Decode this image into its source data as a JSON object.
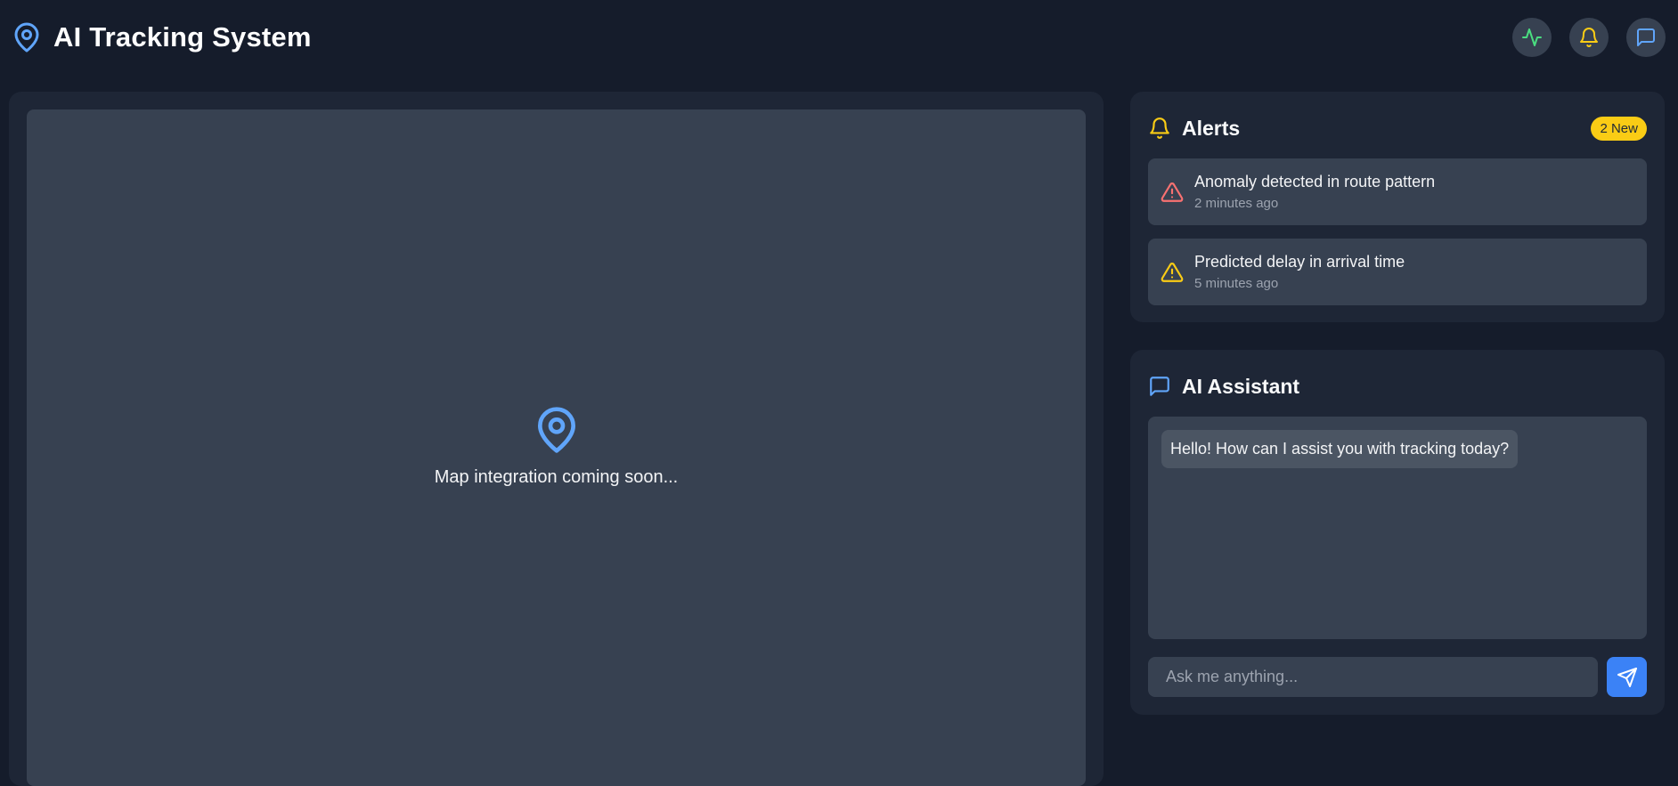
{
  "header": {
    "title": "AI Tracking System",
    "logo_icon": "map-pin-icon",
    "actions": [
      {
        "icon": "activity-icon",
        "color": "#4ade80"
      },
      {
        "icon": "bell-icon",
        "color": "#facc15"
      },
      {
        "icon": "message-square-icon",
        "color": "#60a5fa"
      }
    ]
  },
  "map": {
    "placeholder_icon": "map-pin-icon",
    "placeholder_text": "Map integration coming soon..."
  },
  "alerts": {
    "title": "Alerts",
    "icon": "bell-icon",
    "badge": "2 New",
    "items": [
      {
        "title": "Anomaly detected in route pattern",
        "time": "2 minutes ago",
        "icon": "alert-triangle-icon",
        "color": "#f87171"
      },
      {
        "title": "Predicted delay in arrival time",
        "time": "5 minutes ago",
        "icon": "alert-triangle-icon",
        "color": "#facc15"
      }
    ]
  },
  "assistant": {
    "title": "AI Assistant",
    "icon": "message-square-icon",
    "messages": [
      {
        "text": "Hello! How can I assist you with tracking today?"
      }
    ],
    "input_placeholder": "Ask me anything...",
    "send_icon": "send-icon"
  },
  "colors": {
    "background": "#151c2b",
    "panel": "#1e2636",
    "surface": "#374151",
    "accent": "#3b82f6"
  }
}
